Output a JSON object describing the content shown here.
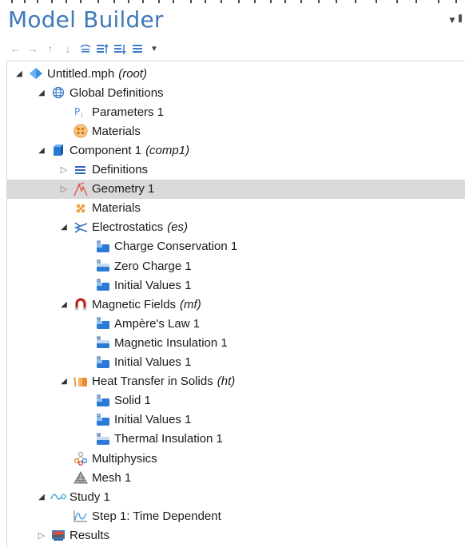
{
  "panel": {
    "title": "Model Builder",
    "menu_glyph": "▼"
  },
  "toolbar": [
    {
      "icon": "back-arrow-icon",
      "glyph": "←",
      "enabled": false
    },
    {
      "icon": "forward-arrow-icon",
      "glyph": "→",
      "enabled": false
    },
    {
      "icon": "move-up-icon",
      "glyph": "↑",
      "enabled": false
    },
    {
      "icon": "move-down-icon",
      "glyph": "↓",
      "enabled": false
    },
    {
      "icon": "show-icon",
      "glyph": "",
      "enabled": true
    },
    {
      "icon": "collapse-all-icon",
      "glyph": "",
      "enabled": true
    },
    {
      "icon": "expand-all-icon",
      "glyph": "",
      "enabled": true
    },
    {
      "icon": "show-more-icon",
      "glyph": "",
      "enabled": true
    },
    {
      "icon": "toolbar-dropdown-icon",
      "glyph": "▼",
      "enabled": true
    }
  ],
  "tree": [
    {
      "label": "Untitled.mph",
      "tag": "(root)",
      "icon": "model-root-icon",
      "toggle": "open",
      "level": 0
    },
    {
      "label": "Global Definitions",
      "tag": "",
      "icon": "globe-icon",
      "toggle": "open",
      "level": 1
    },
    {
      "label": "Parameters 1",
      "tag": "",
      "icon": "parameters-icon",
      "toggle": "none",
      "level": 2
    },
    {
      "label": "Materials",
      "tag": "",
      "icon": "materials-global-icon",
      "toggle": "none",
      "level": 2
    },
    {
      "label": "Component 1",
      "tag": "(comp1)",
      "icon": "component-icon",
      "toggle": "open",
      "level": 1
    },
    {
      "label": "Definitions",
      "tag": "",
      "icon": "definitions-icon",
      "toggle": "closed",
      "level": 2
    },
    {
      "label": "Geometry 1",
      "tag": "",
      "icon": "geometry-icon",
      "toggle": "closed",
      "level": 2,
      "selected": true
    },
    {
      "label": "Materials",
      "tag": "",
      "icon": "materials-icon",
      "toggle": "none",
      "level": 2
    },
    {
      "label": "Electrostatics",
      "tag": "(es)",
      "icon": "electrostatics-icon",
      "toggle": "open",
      "level": 2
    },
    {
      "label": "Charge Conservation 1",
      "tag": "",
      "icon": "physics-feature-icon",
      "toggle": "none",
      "level": 3
    },
    {
      "label": "Zero Charge 1",
      "tag": "",
      "icon": "boundary-condition-icon",
      "toggle": "none",
      "level": 3
    },
    {
      "label": "Initial Values 1",
      "tag": "",
      "icon": "physics-feature-icon",
      "toggle": "none",
      "level": 3
    },
    {
      "label": "Magnetic Fields",
      "tag": "(mf)",
      "icon": "magnet-icon",
      "toggle": "open",
      "level": 2
    },
    {
      "label": "Ampère's Law 1",
      "tag": "",
      "icon": "physics-feature-icon",
      "toggle": "none",
      "level": 3
    },
    {
      "label": "Magnetic Insulation 1",
      "tag": "",
      "icon": "boundary-condition-icon",
      "toggle": "none",
      "level": 3
    },
    {
      "label": "Initial Values 1",
      "tag": "",
      "icon": "physics-feature-icon",
      "toggle": "none",
      "level": 3
    },
    {
      "label": "Heat Transfer in Solids",
      "tag": "(ht)",
      "icon": "heat-transfer-icon",
      "toggle": "open",
      "level": 2
    },
    {
      "label": "Solid 1",
      "tag": "",
      "icon": "physics-feature-icon",
      "toggle": "none",
      "level": 3
    },
    {
      "label": "Initial Values 1",
      "tag": "",
      "icon": "physics-feature-icon",
      "toggle": "none",
      "level": 3
    },
    {
      "label": "Thermal Insulation 1",
      "tag": "",
      "icon": "boundary-condition-icon",
      "toggle": "none",
      "level": 3
    },
    {
      "label": "Multiphysics",
      "tag": "",
      "icon": "multiphysics-icon",
      "toggle": "none",
      "level": 2
    },
    {
      "label": "Mesh 1",
      "tag": "",
      "icon": "mesh-icon",
      "toggle": "none",
      "level": 2
    },
    {
      "label": "Study 1",
      "tag": "",
      "icon": "study-icon",
      "toggle": "open",
      "level": 1
    },
    {
      "label": "Step 1: Time Dependent",
      "tag": "",
      "icon": "time-dependent-icon",
      "toggle": "none",
      "level": 2
    },
    {
      "label": "Results",
      "tag": "",
      "icon": "results-icon",
      "toggle": "closed",
      "level": 1
    }
  ]
}
